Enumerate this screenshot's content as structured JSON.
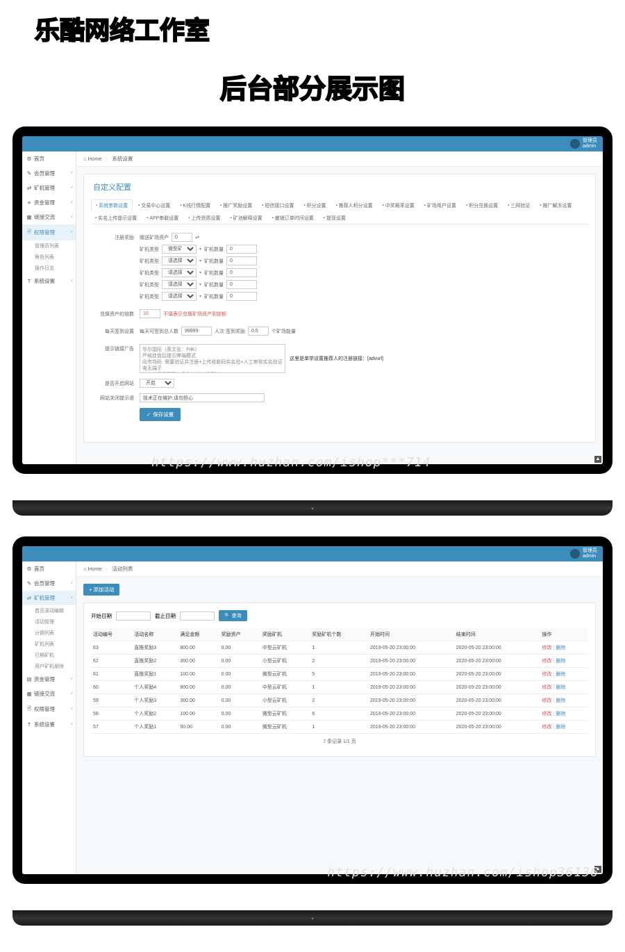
{
  "header": {
    "brand_title": "乐酷网络工作室",
    "sub_title": "后台部分展示图"
  },
  "user": {
    "role": "管理员",
    "name": "admin"
  },
  "screen1": {
    "breadcrumb": {
      "home": "Home",
      "current": "系统设置"
    },
    "sidebar": [
      {
        "icon": "⚙",
        "label": "首页",
        "exp": false
      },
      {
        "icon": "✎",
        "label": "会员管理",
        "exp": true
      },
      {
        "icon": "⇄",
        "label": "矿机管理",
        "exp": true
      },
      {
        "icon": "≡",
        "label": "资金管理",
        "exp": true
      },
      {
        "icon": "▦",
        "label": "链接交流",
        "exp": true
      },
      {
        "icon": "🗎",
        "label": "权限管理",
        "exp": true,
        "active": true
      },
      {
        "icon": "T",
        "label": "系统设置",
        "exp": true
      }
    ],
    "sidebar_sub": [
      "管理员列表",
      "角色列表",
      "操作日志"
    ],
    "page_title": "自定义配置",
    "tabs": [
      "系统参数设置",
      "交易中心设置",
      "K线行情配置",
      "推广奖励设置",
      "短信接口设置",
      "积分设置",
      "推荐人积分设置",
      "中奖概率设置",
      "矿场用户设置",
      "积分兑换设置",
      "三网验证",
      "推广解冻设置",
      "实名上传提示设置",
      "APP串联设置",
      "上传资质设置",
      "矿池解释设置",
      "撤销订单时间设置",
      "提现设置"
    ],
    "form": {
      "row1_label": "注册奖励",
      "row1_text": "赠送矿场资产",
      "row1_val": "0",
      "miner_rows": [
        {
          "type_label": "矿机类型",
          "type_val": "微型矿机（赠",
          "qty_label": "矿机数量",
          "qty_val": "0"
        },
        {
          "type_label": "矿机类型",
          "type_val": "请选择",
          "qty_label": "矿机数量",
          "qty_val": "0"
        },
        {
          "type_label": "矿机类型",
          "type_val": "请选择",
          "qty_label": "矿机数量",
          "qty_val": "0"
        },
        {
          "type_label": "矿机类型",
          "type_val": "请选择",
          "qty_label": "矿机数量",
          "qty_val": "0"
        },
        {
          "type_label": "矿机类型",
          "type_val": "请选择",
          "qty_label": "矿机数量",
          "qty_val": "0"
        }
      ],
      "row3_label": "兑换资产的倍数",
      "row3_val": "10",
      "row3_hint": "不填表示兑换矿场资产到锁额",
      "row4_label": "每天签到设置",
      "row4_text1": "每天可签到总人数",
      "row4_val1": "99999",
      "row4_text2": "人次 签到奖励",
      "row4_val2": "0.5",
      "row4_text3": "个矿场能量",
      "row5_label": "提示链接广告",
      "row5_textarea": "华尔国际（英文名：FHK）\n严格挂盘后提示弊端模式\n向市场码 需要验证并注册+上传收款码实名验+人工审核实名验证 电无端子\n仿有端子解不了的是你过差长没开过",
      "row5_hint": "这里是单举设置推荐人的注册链接：[advurl]",
      "row6_label": "是否开启网站",
      "row6_val": "开启",
      "row7_label": "网站关闭提示语",
      "row7_val": "技术正在维护,请勿担心",
      "save_btn": "保存设置"
    }
  },
  "screen2": {
    "breadcrumb": {
      "home": "Home",
      "current": "活动列表"
    },
    "sidebar": [
      {
        "icon": "⚙",
        "label": "首页",
        "exp": false
      },
      {
        "icon": "✎",
        "label": "会员管理",
        "exp": true
      },
      {
        "icon": "⇄",
        "label": "矿机管理",
        "exp": true,
        "active": true
      },
      {
        "icon": "▤",
        "label": "资金管理",
        "exp": true
      },
      {
        "icon": "▦",
        "label": "链接交流",
        "exp": true
      },
      {
        "icon": "🗎",
        "label": "权限管理",
        "exp": true
      },
      {
        "icon": "T",
        "label": "系统设置",
        "exp": true
      }
    ],
    "sidebar_sub": [
      "首页滚动编辑",
      "活动管理",
      "分佣列表",
      "矿机列表",
      "已期矿机",
      "用户矿机册除"
    ],
    "add_btn": "添加活动",
    "search": {
      "start_label": "开始日期",
      "end_label": "截止日期",
      "btn": "查询"
    },
    "columns": [
      "活动编号",
      "活动名称",
      "满足金额",
      "奖励资产",
      "奖励矿机",
      "奖励矿机个数",
      "开始时间",
      "结束时间",
      "操作"
    ],
    "rows": [
      {
        "id": "63",
        "name": "直推奖励3",
        "amount": "800.00",
        "reward": "0.00",
        "miner": "中型云矿机",
        "count": "1",
        "start": "2019-05-20 23:00:00",
        "end": "2020-05-20 23:00:00"
      },
      {
        "id": "62",
        "name": "直推奖励2",
        "amount": "300.00",
        "reward": "0.00",
        "miner": "小型云矿机",
        "count": "2",
        "start": "2019-05-20 23:00:00",
        "end": "2020-05-20 23:00:00"
      },
      {
        "id": "61",
        "name": "直推奖励1",
        "amount": "100.00",
        "reward": "0.00",
        "miner": "微型云矿机",
        "count": "5",
        "start": "2019-05-20 23:00:00",
        "end": "2020-05-20 23:00:00"
      },
      {
        "id": "60",
        "name": "个人奖励4",
        "amount": "800.00",
        "reward": "0.00",
        "miner": "中型云矿机",
        "count": "1",
        "start": "2019-05-20 23:00:00",
        "end": "2020-05-20 23:00:00"
      },
      {
        "id": "59",
        "name": "个人奖励3",
        "amount": "300.00",
        "reward": "0.00",
        "miner": "小型云矿机",
        "count": "2",
        "start": "2019-05-20 23:00:00",
        "end": "2020-05-20 23:00:00"
      },
      {
        "id": "58",
        "name": "个人奖励2",
        "amount": "100.00",
        "reward": "0.00",
        "miner": "微型云矿机",
        "count": "6",
        "start": "2019-05-20 23:00:00",
        "end": "2020-05-20 23:00:00"
      },
      {
        "id": "57",
        "name": "个人奖励1",
        "amount": "50.00",
        "reward": "0.00",
        "miner": "微型云矿机",
        "count": "1",
        "start": "2019-05-20 23:00:00",
        "end": "2020-05-20 23:00:00"
      }
    ],
    "op_edit": "修改",
    "op_del": "删除",
    "pager": "7 条记录 1/1 页"
  },
  "watermarks": {
    "wm1": "https://www.huzhan.com/ishop***714",
    "wm2": "https://www.huzhan.com/ishop36136"
  }
}
